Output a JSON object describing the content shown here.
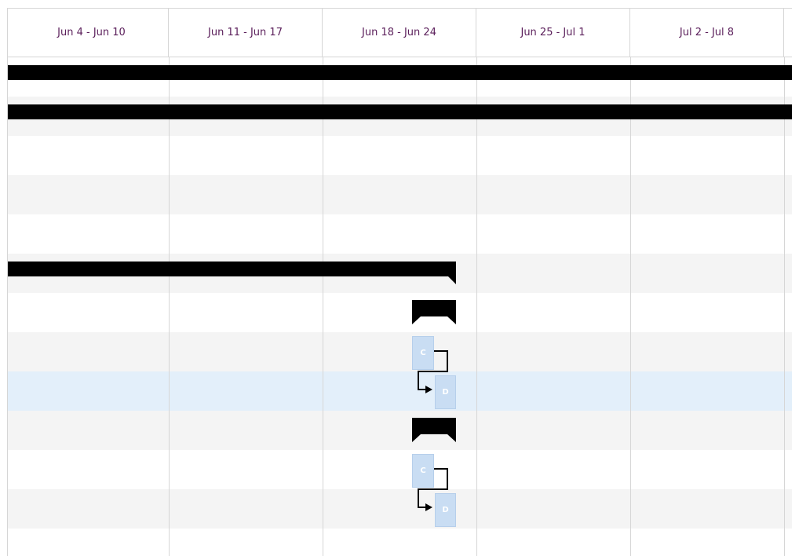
{
  "timeline": {
    "weeks": [
      {
        "label": "Jun 4 - Jun 10"
      },
      {
        "label": "Jun 11 - Jun 17"
      },
      {
        "label": "Jun 18 - Jun 24"
      },
      {
        "label": "Jun 25 - Jul 1"
      },
      {
        "label": "Jul 2 - Jul 8"
      }
    ]
  },
  "colors": {
    "header_text": "#5a1e5a",
    "grid_line": "#d6d6d6",
    "row_alt": "#f4f4f4",
    "row_selected": "#e3effa",
    "summary_bar": "#000000",
    "task_bar": "#c9ddf3"
  },
  "tasks": {
    "task_1_letter": "C",
    "task_2_letter": "D",
    "task_3_letter": "C",
    "task_4_letter": "D"
  }
}
